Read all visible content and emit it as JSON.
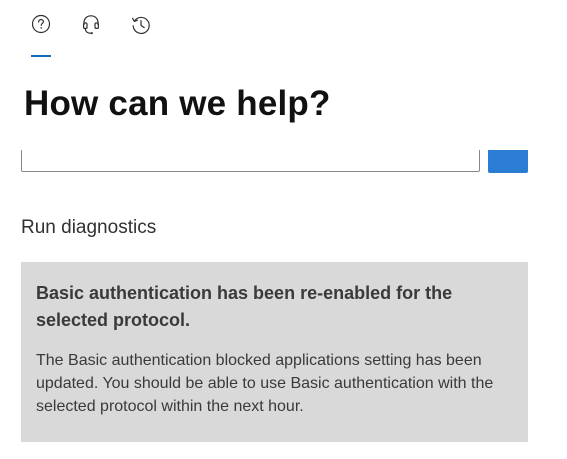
{
  "tabs": [
    {
      "name": "help",
      "icon": "question-circle-icon",
      "active": true
    },
    {
      "name": "contact-support",
      "icon": "headset-icon",
      "active": false
    },
    {
      "name": "history",
      "icon": "history-icon",
      "active": false
    }
  ],
  "header": {
    "title": "How can we help?"
  },
  "search": {
    "value": "",
    "button_icon": "search-icon"
  },
  "diagnostics": {
    "section_title": "Run diagnostics",
    "result_heading": "Basic authentication has been re-enabled for the selected protocol.",
    "result_body": "The Basic authentication blocked applications setting has been updated. You should be able to use Basic authentication with the selected protocol within the next hour."
  },
  "colors": {
    "accent": "#0f6cbd",
    "search_button": "#2b7cd3",
    "card_background": "#d9d9d9"
  }
}
